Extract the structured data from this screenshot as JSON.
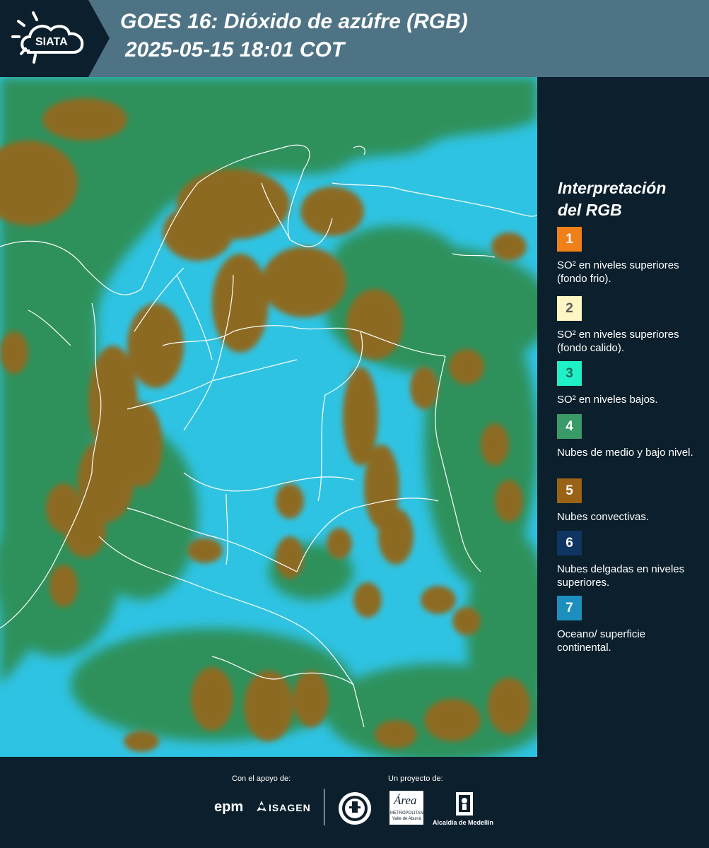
{
  "header": {
    "logo_text": "SIATA",
    "title_line1": "GOES 16: Dióxido de azúfre (RGB)",
    "title_line2": "2025-05-15 18:01 COT"
  },
  "legend": {
    "title_line1": "Interpretación",
    "title_line2": "del RGB",
    "items": [
      {
        "number": "1",
        "label": "SO² en niveles superiores (fondo frio).",
        "color": "#f08019",
        "text_color": "#ffffff"
      },
      {
        "number": "2",
        "label": "SO² en niveles superiores (fondo calido).",
        "color": "#fff6c4",
        "text_color": "#5a5a5a"
      },
      {
        "number": "3",
        "label": "SO² en niveles bajos.",
        "color": "#1ff0c8",
        "text_color": "#1a6a5a"
      },
      {
        "number": "4",
        "label": "Nubes de medio y bajo nivel.",
        "color": "#3a9a68",
        "text_color": "#ffffff"
      },
      {
        "number": "5",
        "label": "Nubes convectivas.",
        "color": "#9a6214",
        "text_color": "#ffffff"
      },
      {
        "number": "6",
        "label": "Nubes delgadas en niveles superiores.",
        "color": "#0f3563",
        "text_color": "#ffffff"
      },
      {
        "number": "7",
        "label": "Oceano/ superficie continental.",
        "color": "#1d8fbf",
        "text_color": "#ffffff"
      }
    ]
  },
  "footer": {
    "support_caption": "Con el apoyo de:",
    "project_caption": "Un proyecto de:",
    "epm": "epm",
    "isagen": "ISAGEN",
    "area_script": "Área",
    "area_line1": "METROPOLITANA",
    "area_line2": "Valle de Aburrá",
    "alcaldia": "Alcaldía de Medellín"
  },
  "map_colors": {
    "ocean_land": "#2fc3e3",
    "low_mid_cloud": "#2f8f55",
    "convective": "#8d6a22",
    "borders": "#ffffff"
  }
}
